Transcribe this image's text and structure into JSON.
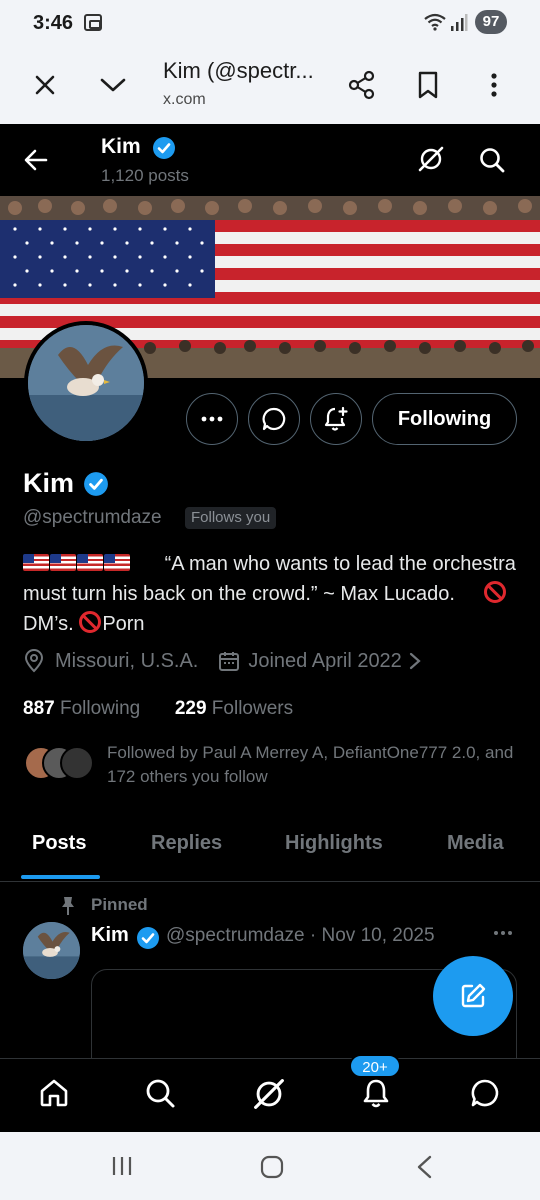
{
  "status_bar": {
    "time": "3:46",
    "battery": "97"
  },
  "browser": {
    "title": "Kim (@spectr...",
    "url": "x.com"
  },
  "header": {
    "name": "Kim",
    "posts": "1,120 posts"
  },
  "profile": {
    "name": "Kim",
    "handle": "@spectrumdaze",
    "follows_you": "Follows you",
    "follow_button": "Following",
    "bio": {
      "quote": "“A man who wants to lead the orchestra must turn his back on the crowd.” ~ Max Lucado.",
      "dms": "DM’s.",
      "porn": "Porn"
    },
    "location": "Missouri, U.S.A.",
    "joined": "Joined April 2022",
    "following_count": "887",
    "following_label": "Following",
    "followers_count": "229",
    "followers_label": "Followers",
    "followed_by": "Followed by Paul A Merrey A, DefiantOne777 2.0, and 172 others you follow"
  },
  "tabs": [
    "Posts",
    "Replies",
    "Highlights",
    "Media"
  ],
  "pinned_post": {
    "pinned_label": "Pinned",
    "name": "Kim",
    "meta": "@spectrumdaze · Nov 10, 2025"
  },
  "notifications_badge": "20+",
  "colors": {
    "accent": "#1d9bf0",
    "background": "#000000",
    "muted": "#71767b"
  }
}
